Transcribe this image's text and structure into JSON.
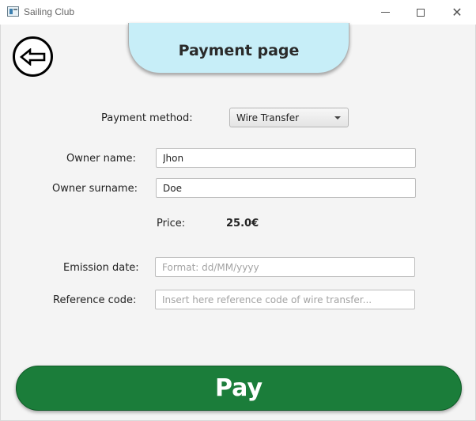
{
  "window": {
    "title": "Sailing Club"
  },
  "window_controls": {
    "minimize": "minimize",
    "maximize": "maximize",
    "close": "✕"
  },
  "header": {
    "title": "Payment page"
  },
  "back_button": {
    "icon": "arrow-left-icon"
  },
  "form": {
    "payment_method_label": "Payment method:",
    "payment_method_value": "Wire Transfer",
    "owner_name_label": "Owner name:",
    "owner_name_value": "Jhon",
    "owner_surname_label": "Owner surname:",
    "owner_surname_value": "Doe",
    "price_label": "Price:",
    "price_value": "25.0€",
    "emission_date_label": "Emission date:",
    "emission_date_placeholder": "Format: dd/MM/yyyy",
    "reference_code_label": "Reference code:",
    "reference_code_placeholder": "Insert here reference code of wire transfer..."
  },
  "pay_button": {
    "label": "Pay"
  },
  "colors": {
    "header_bg": "#c7eef8",
    "pay_bg": "#1b7d3a",
    "content_bg": "#f4f4f4"
  }
}
